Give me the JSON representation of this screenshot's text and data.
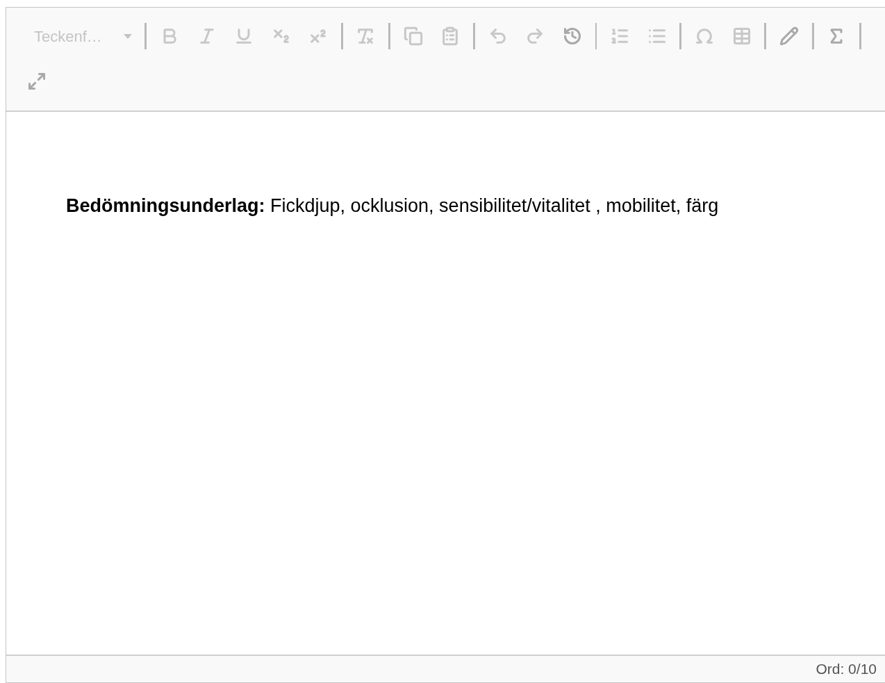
{
  "toolbar": {
    "font_select": {
      "value": "Teckenf…",
      "disabled": true
    },
    "groups": [
      [
        {
          "kind": "bold",
          "disabled": true
        },
        {
          "kind": "italic",
          "disabled": true
        },
        {
          "kind": "underline",
          "disabled": true
        },
        {
          "kind": "subscript",
          "disabled": true
        },
        {
          "kind": "superscript",
          "disabled": true
        }
      ],
      [
        {
          "kind": "clear-format",
          "disabled": true
        }
      ],
      [
        {
          "kind": "copy",
          "disabled": true
        },
        {
          "kind": "paste",
          "disabled": true
        }
      ],
      [
        {
          "kind": "undo",
          "disabled": true
        },
        {
          "kind": "redo",
          "disabled": true
        },
        {
          "kind": "history",
          "disabled": false
        }
      ],
      [
        {
          "kind": "numbered-list",
          "disabled": true
        },
        {
          "kind": "bulleted-list",
          "disabled": true
        }
      ],
      [
        {
          "kind": "omega",
          "disabled": true
        },
        {
          "kind": "table",
          "disabled": true
        }
      ],
      [
        {
          "kind": "pencil",
          "disabled": false
        }
      ],
      [
        {
          "kind": "sigma",
          "disabled": false
        }
      ],
      [
        {
          "kind": "fullscreen",
          "disabled": false
        }
      ]
    ]
  },
  "content": {
    "paragraph": "**Bedömningsunderlag:** Fickdjup, ocklusion, sensibilitet/vitalitet , mobilitet, färg"
  },
  "status_bar": {
    "word_count": "Ord: 0/10"
  }
}
